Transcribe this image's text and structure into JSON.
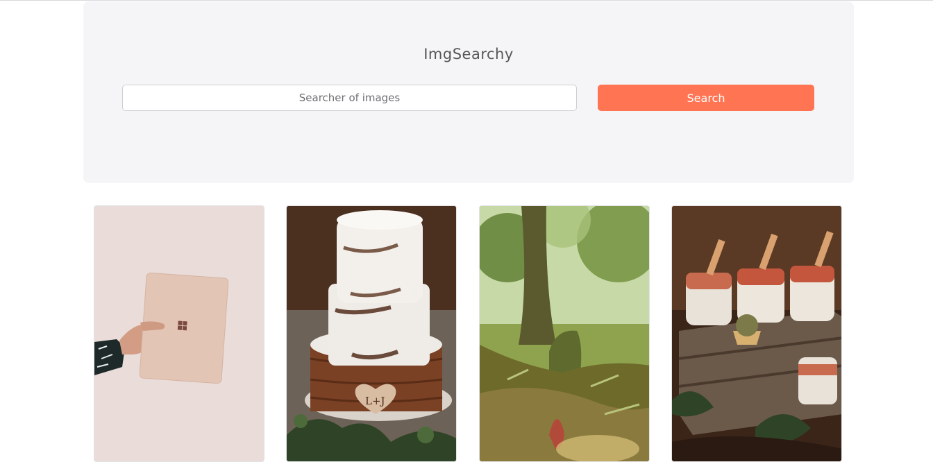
{
  "app": {
    "title": "ImgSearchy"
  },
  "search": {
    "placeholder": "Searcher of images",
    "value": "",
    "button_label": "Search"
  },
  "colors": {
    "accent": "#ff7452",
    "panel_background": "#f5f5f7",
    "title_text": "#555558"
  },
  "results": [
    {
      "subject": "hand holding laptop",
      "icon": "image-laptop"
    },
    {
      "subject": "wedding cake",
      "icon": "image-cake"
    },
    {
      "subject": "forest",
      "icon": "image-forest"
    },
    {
      "subject": "dessert jars",
      "icon": "image-dessert"
    }
  ]
}
